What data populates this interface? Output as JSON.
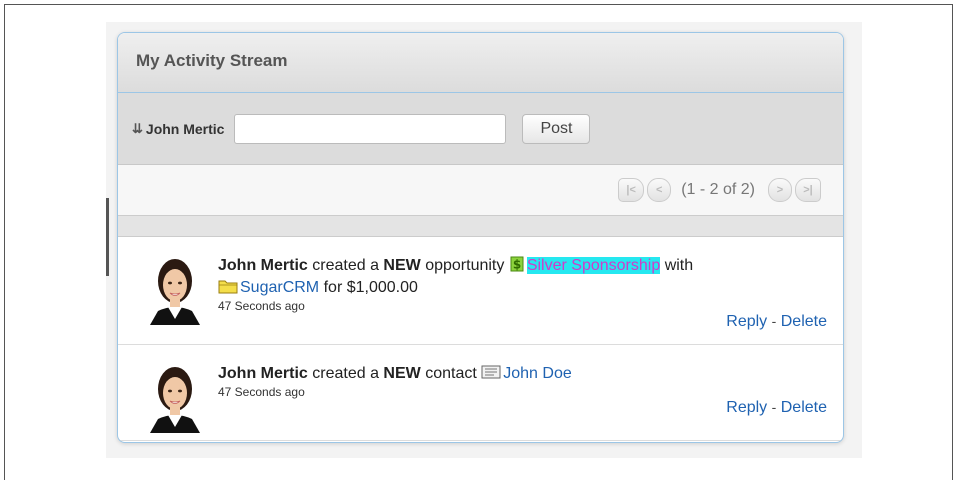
{
  "dashlet": {
    "title": "My Activity Stream"
  },
  "post_bar": {
    "user_name": "John Mertic",
    "post_input_value": "",
    "post_button_label": "Post"
  },
  "pager": {
    "info": "(1 - 2 of 2)",
    "first_label": "|<",
    "prev_label": "<",
    "next_label": ">",
    "last_label": ">|"
  },
  "activities": [
    {
      "actor": "John Mertic",
      "verb": "created a",
      "new_label": "NEW",
      "object_type": "opportunity",
      "object_icon": "opportunity-icon",
      "object_name": "Silver Sponsorship",
      "with_text": "with",
      "related_icon": "account-folder-icon",
      "related_name": "SugarCRM",
      "amount_text": "for $1,000.00",
      "time_ago": "47 Seconds ago",
      "reply_label": "Reply",
      "separator": "-",
      "delete_label": "Delete"
    },
    {
      "actor": "John Mertic",
      "verb": "created a",
      "new_label": "NEW",
      "object_type": "contact",
      "object_icon": "contact-card-icon",
      "object_name": "John Doe",
      "time_ago": "47 Seconds ago",
      "reply_label": "Reply",
      "separator": "-",
      "delete_label": "Delete"
    }
  ],
  "colors": {
    "link": "#1f62b1",
    "border_accent": "#9cc6e6",
    "highlight_bg": "#25e8f0",
    "highlight_text": "#d03bc9"
  }
}
